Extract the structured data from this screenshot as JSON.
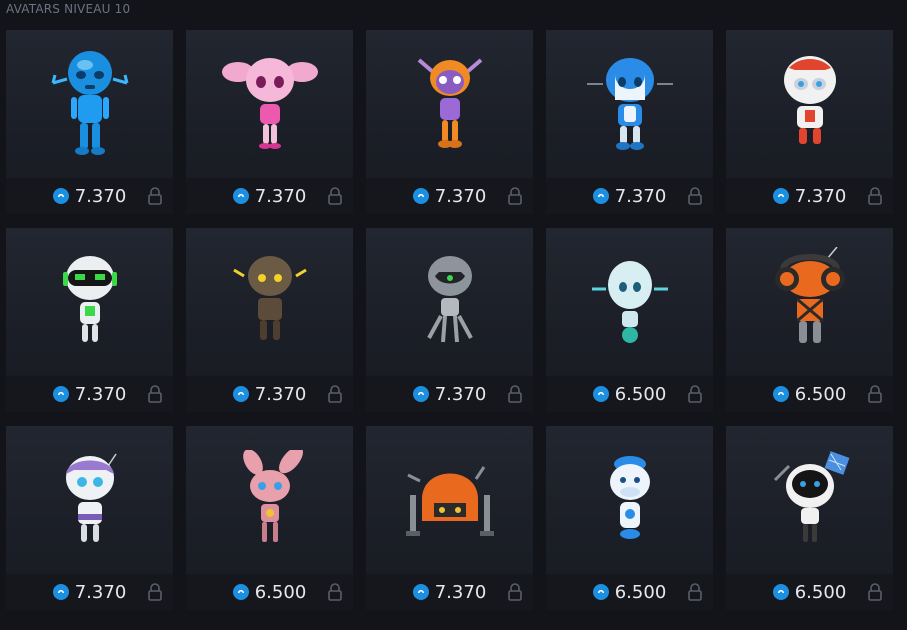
{
  "section": {
    "title": "AVATARS NIVEAU 10"
  },
  "colors": {
    "coin": "#1d8fe0",
    "card_bg": "#1f232b",
    "bar_bg": "#15171d",
    "text": "#e6e8ee"
  },
  "avatars": [
    {
      "name": "blue-chrome-robot",
      "price": "7.370",
      "icon": "coin-icon",
      "locked": true
    },
    {
      "name": "pink-robot",
      "price": "7.370",
      "icon": "coin-icon",
      "locked": true
    },
    {
      "name": "orange-purple-robot",
      "price": "7.370",
      "icon": "coin-icon",
      "locked": true
    },
    {
      "name": "blue-white-robot",
      "price": "7.370",
      "icon": "coin-icon",
      "locked": true
    },
    {
      "name": "red-white-robot",
      "price": "7.370",
      "icon": "coin-icon",
      "locked": true
    },
    {
      "name": "green-visor-robot",
      "price": "7.370",
      "icon": "coin-icon",
      "locked": true
    },
    {
      "name": "rusty-robot",
      "price": "7.370",
      "icon": "coin-icon",
      "locked": true
    },
    {
      "name": "silver-alien-robot",
      "price": "7.370",
      "icon": "coin-icon",
      "locked": true
    },
    {
      "name": "ice-robot",
      "price": "6.500",
      "icon": "coin-icon",
      "locked": true
    },
    {
      "name": "dj-headphone-robot",
      "price": "6.500",
      "icon": "coin-icon",
      "locked": true
    },
    {
      "name": "purple-helmet-robot",
      "price": "7.370",
      "icon": "coin-icon",
      "locked": true
    },
    {
      "name": "pink-bunny-robot",
      "price": "6.500",
      "icon": "coin-icon",
      "locked": true
    },
    {
      "name": "dome-walker-robot",
      "price": "7.370",
      "icon": "coin-icon",
      "locked": true
    },
    {
      "name": "blue-cow-robot",
      "price": "6.500",
      "icon": "coin-icon",
      "locked": true
    },
    {
      "name": "satellite-robot",
      "price": "6.500",
      "icon": "coin-icon",
      "locked": true
    }
  ]
}
